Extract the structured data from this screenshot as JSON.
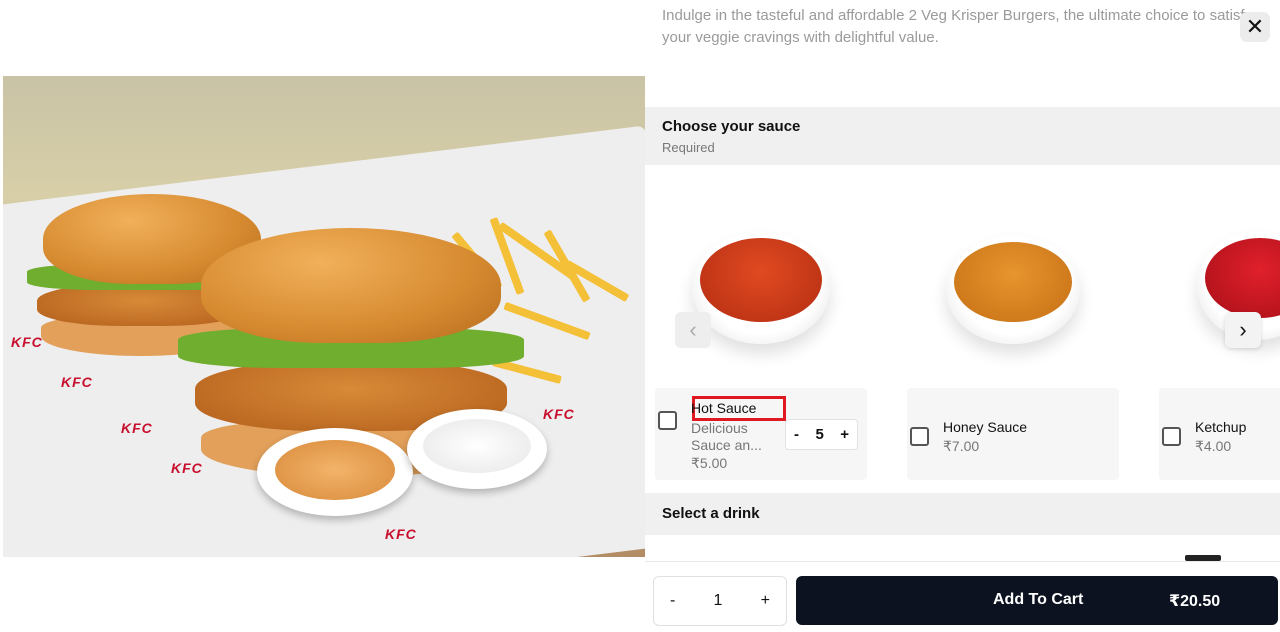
{
  "product": {
    "description": "Indulge in the tasteful and affordable 2 Veg Krisper Burgers, the ultimate choice to satisfy your veggie cravings with delightful value.",
    "image_alt": "2 Veg Krisper Burgers with fries and dips"
  },
  "hero": {
    "brand_marks": [
      "KFC",
      "KFC",
      "KFC",
      "KFC",
      "KFC",
      "KFC"
    ]
  },
  "close_label": "✕",
  "sauce_section": {
    "title": "Choose your sauce",
    "subtitle": "Required",
    "prev_arrow": "‹",
    "next_arrow": "›",
    "items": [
      {
        "name": "Hot Sauce",
        "desc": "Delicious Sauce an...",
        "price": "₹5.00",
        "qty": "5",
        "minus": "-",
        "plus": "+",
        "color": "#c2361a"
      },
      {
        "name": "Honey Sauce",
        "price": "₹7.00",
        "color": "#d9861f"
      },
      {
        "name": "Ketchup",
        "price": "₹4.00",
        "color": "#c01020"
      }
    ]
  },
  "drink_section": {
    "title": "Select a drink"
  },
  "footer": {
    "qty_minus": "-",
    "qty_value": "1",
    "qty_plus": "+",
    "add_to_cart": "Add To Cart",
    "total": "₹20.50"
  }
}
